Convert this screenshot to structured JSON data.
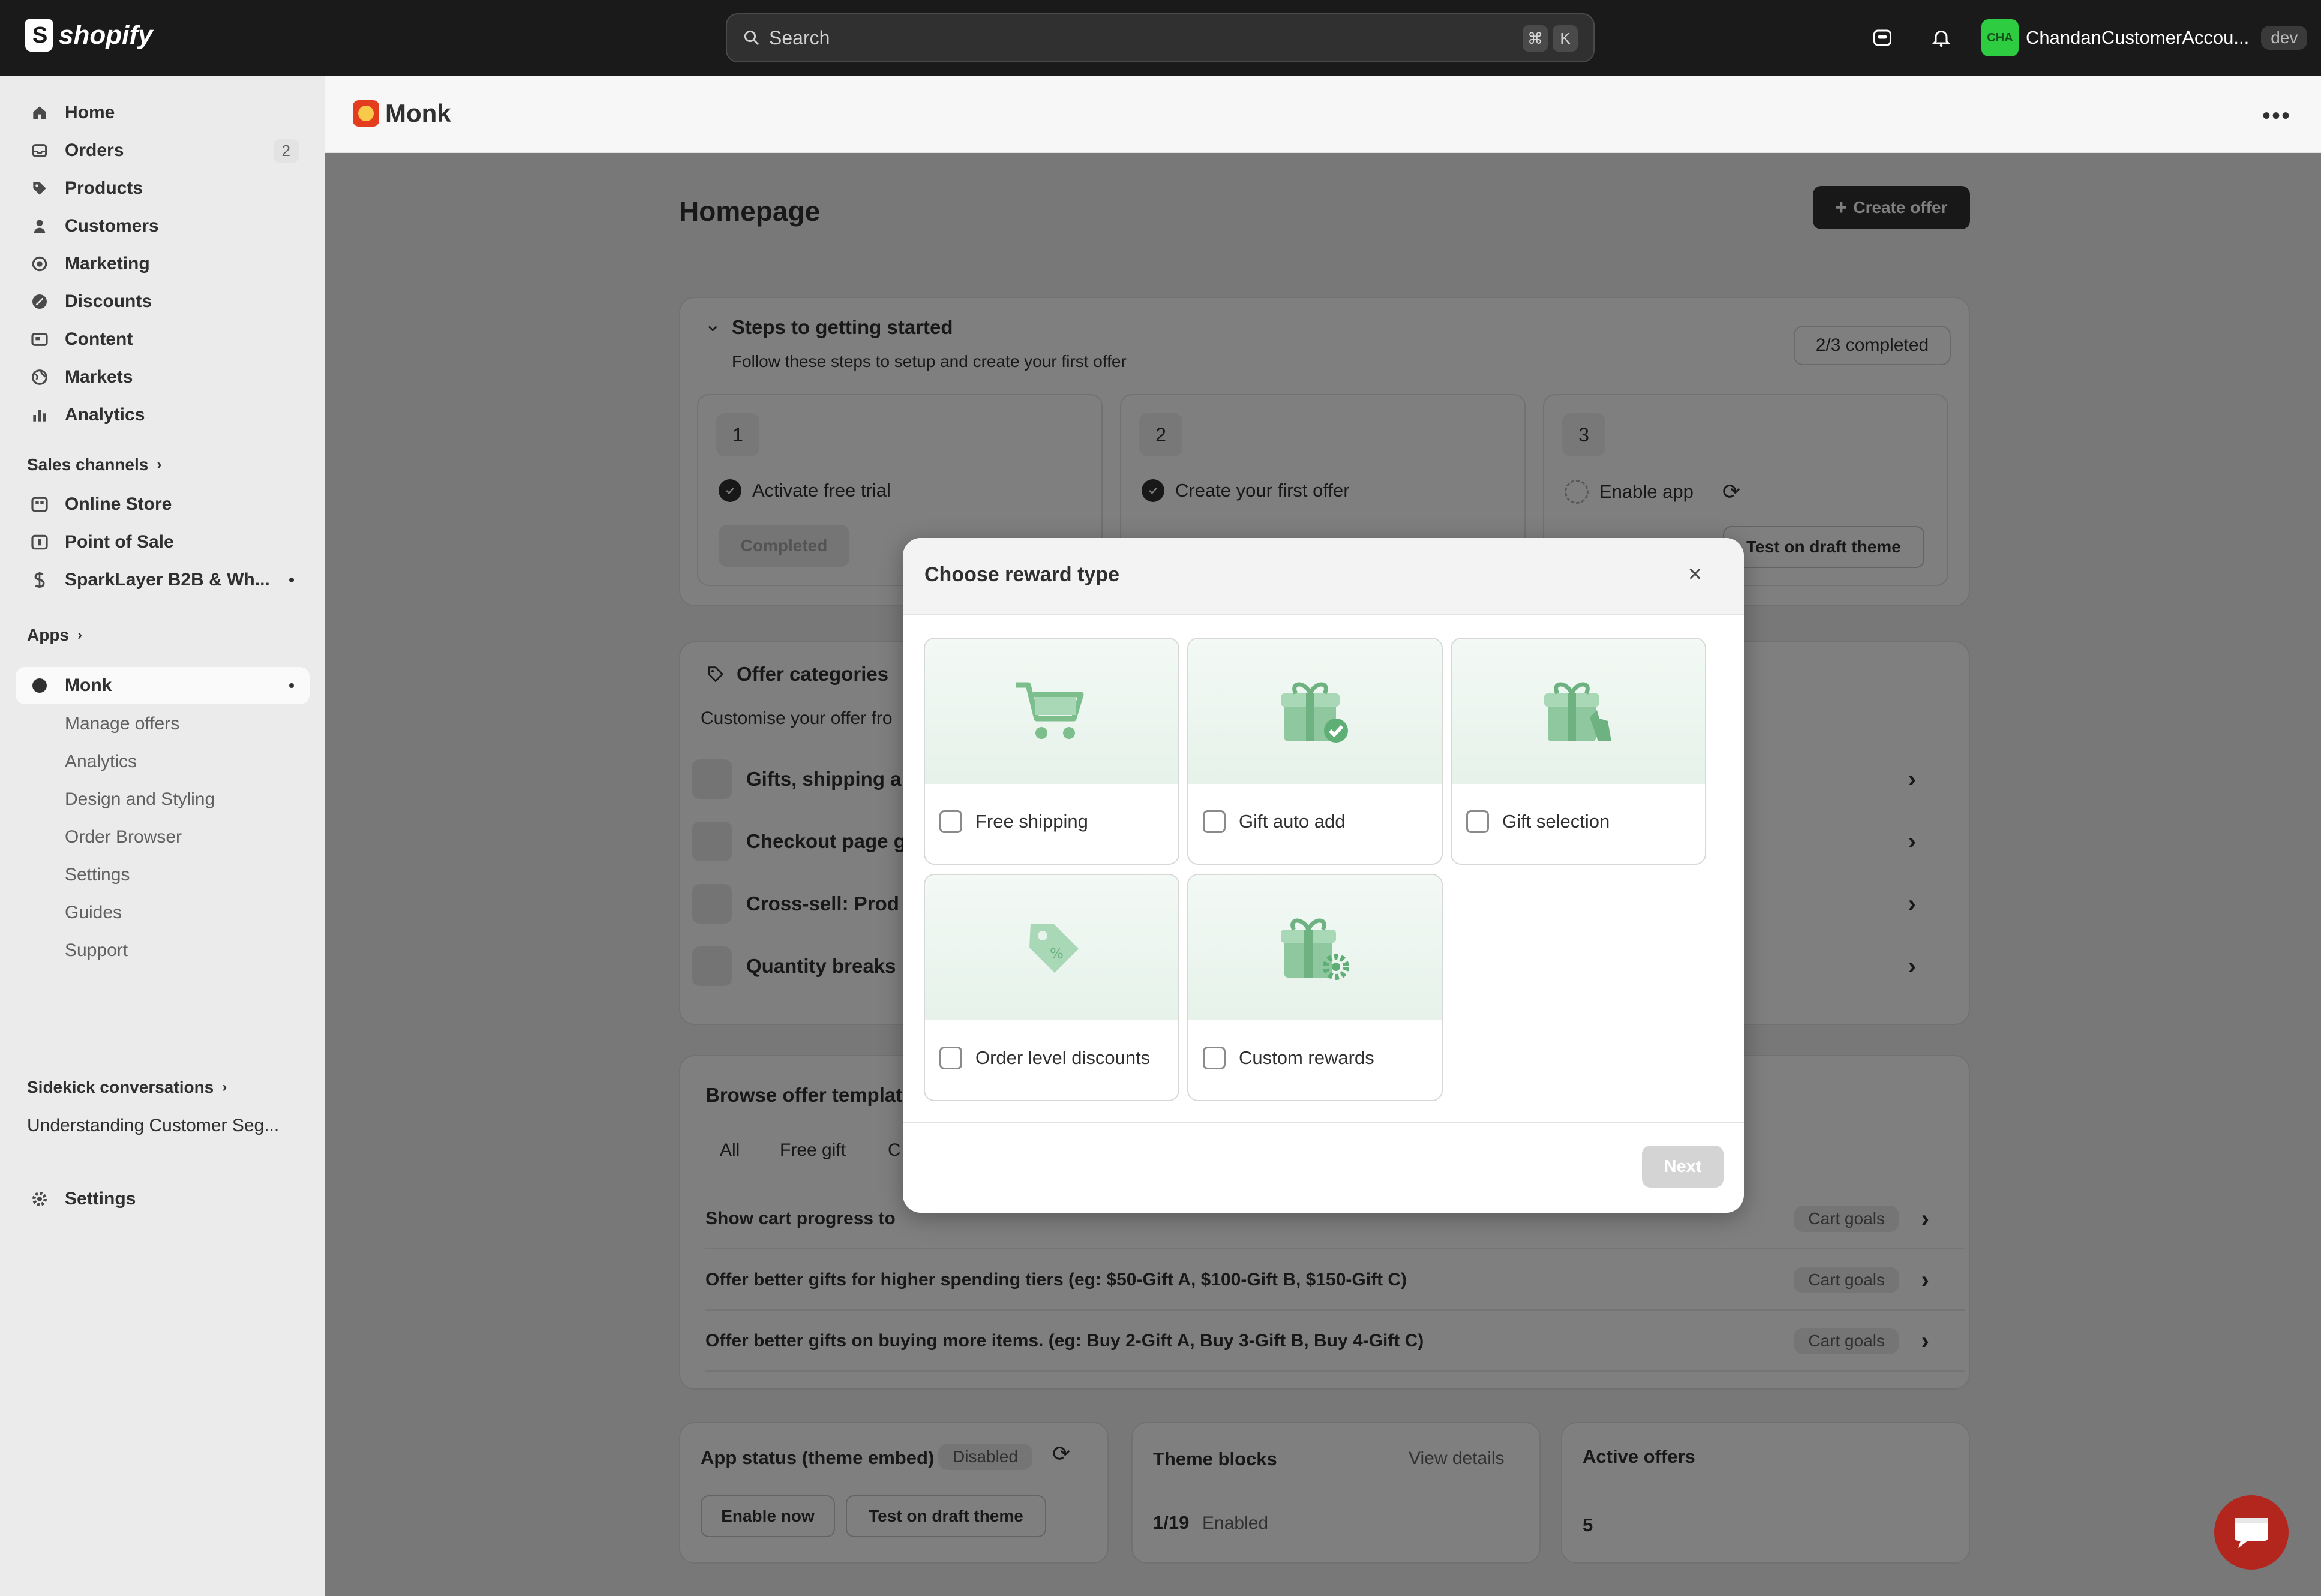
{
  "topbar": {
    "logo_text": "shopify",
    "search_placeholder": "Search",
    "shortcut_cmd": "⌘",
    "shortcut_key": "K",
    "account_initials": "CHA",
    "account_name": "ChandanCustomerAccou...",
    "account_badge": "dev"
  },
  "sidebar": {
    "items": [
      {
        "label": "Home",
        "icon": "home-icon"
      },
      {
        "label": "Orders",
        "icon": "orders-icon",
        "count": "2"
      },
      {
        "label": "Products",
        "icon": "tag-icon"
      },
      {
        "label": "Customers",
        "icon": "person-icon"
      },
      {
        "label": "Marketing",
        "icon": "target-icon"
      },
      {
        "label": "Discounts",
        "icon": "discount-icon"
      },
      {
        "label": "Content",
        "icon": "content-icon"
      },
      {
        "label": "Markets",
        "icon": "globe-icon"
      },
      {
        "label": "Analytics",
        "icon": "bar-chart-icon"
      }
    ],
    "sales_channels_label": "Sales channels",
    "channels": [
      {
        "label": "Online Store",
        "icon": "store-icon"
      },
      {
        "label": "Point of Sale",
        "icon": "pos-icon"
      },
      {
        "label": "SparkLayer B2B & Wh...",
        "icon": "sparklayer-icon"
      }
    ],
    "apps_label": "Apps",
    "app_name": "Monk",
    "app_subitems": [
      "Manage offers",
      "Analytics",
      "Design and Styling",
      "Order Browser",
      "Settings",
      "Guides",
      "Support"
    ],
    "sidekick_label": "Sidekick conversations",
    "sidekick_item": "Understanding Customer Seg...",
    "settings_label": "Settings"
  },
  "app_header": {
    "title": "Monk"
  },
  "page": {
    "title": "Homepage",
    "create_offer": "Create offer",
    "steps": {
      "title": "Steps to getting started",
      "subtitle": "Follow these steps to setup and create your first offer",
      "progress": "2/3 completed",
      "items": [
        {
          "num": "1",
          "label": "Activate free trial",
          "button": "Completed"
        },
        {
          "num": "2",
          "label": "Create your first offer"
        },
        {
          "num": "3",
          "label": "Enable app",
          "button": "Test on draft theme"
        }
      ]
    },
    "categories": {
      "title": "Offer categories",
      "subtitle": "Customise your offer fro",
      "rows": [
        "Gifts, shipping a",
        "Checkout page g",
        "Cross-sell: Prod",
        "Quantity breaks"
      ]
    },
    "templates": {
      "title": "Browse offer templat",
      "tabs": [
        "All",
        "Free gift",
        "C"
      ],
      "rows": [
        {
          "text": "Show cart progress to",
          "tag": "Cart goals"
        },
        {
          "text": "Offer better gifts for higher spending tiers (eg: $50-Gift A, $100-Gift B, $150-Gift C)",
          "tag": "Cart goals"
        },
        {
          "text": "Offer better gifts on buying more items. (eg: Buy 2-Gift A, Buy 3-Gift B, Buy 4-Gift C)",
          "tag": "Cart goals"
        }
      ]
    },
    "app_status": {
      "title": "App status (theme embed)",
      "badge": "Disabled",
      "enable": "Enable now",
      "test": "Test on draft theme"
    },
    "theme_blocks": {
      "title": "Theme blocks",
      "link": "View details",
      "count": "1/19",
      "status": "Enabled"
    },
    "active_offers": {
      "title": "Active offers",
      "count": "5"
    }
  },
  "modal": {
    "title": "Choose reward type",
    "options": [
      {
        "label": "Free shipping",
        "icon": "shopping-cart-icon",
        "checked": false
      },
      {
        "label": "Gift auto add",
        "icon": "gift-check-icon",
        "checked": false
      },
      {
        "label": "Gift selection",
        "icon": "gift-hand-icon",
        "checked": false
      },
      {
        "label": "Order level discounts",
        "icon": "price-tag-icon",
        "checked": false
      },
      {
        "label": "Custom rewards",
        "icon": "gift-gear-icon",
        "checked": false
      }
    ],
    "next_label": "Next"
  },
  "colors": {
    "topbar": "#1a1a1a",
    "accent_green": "#2ecc40",
    "reward_bg": "#e6f2ea",
    "icon_green": "#8fc79f",
    "chat": "#b3261e"
  }
}
